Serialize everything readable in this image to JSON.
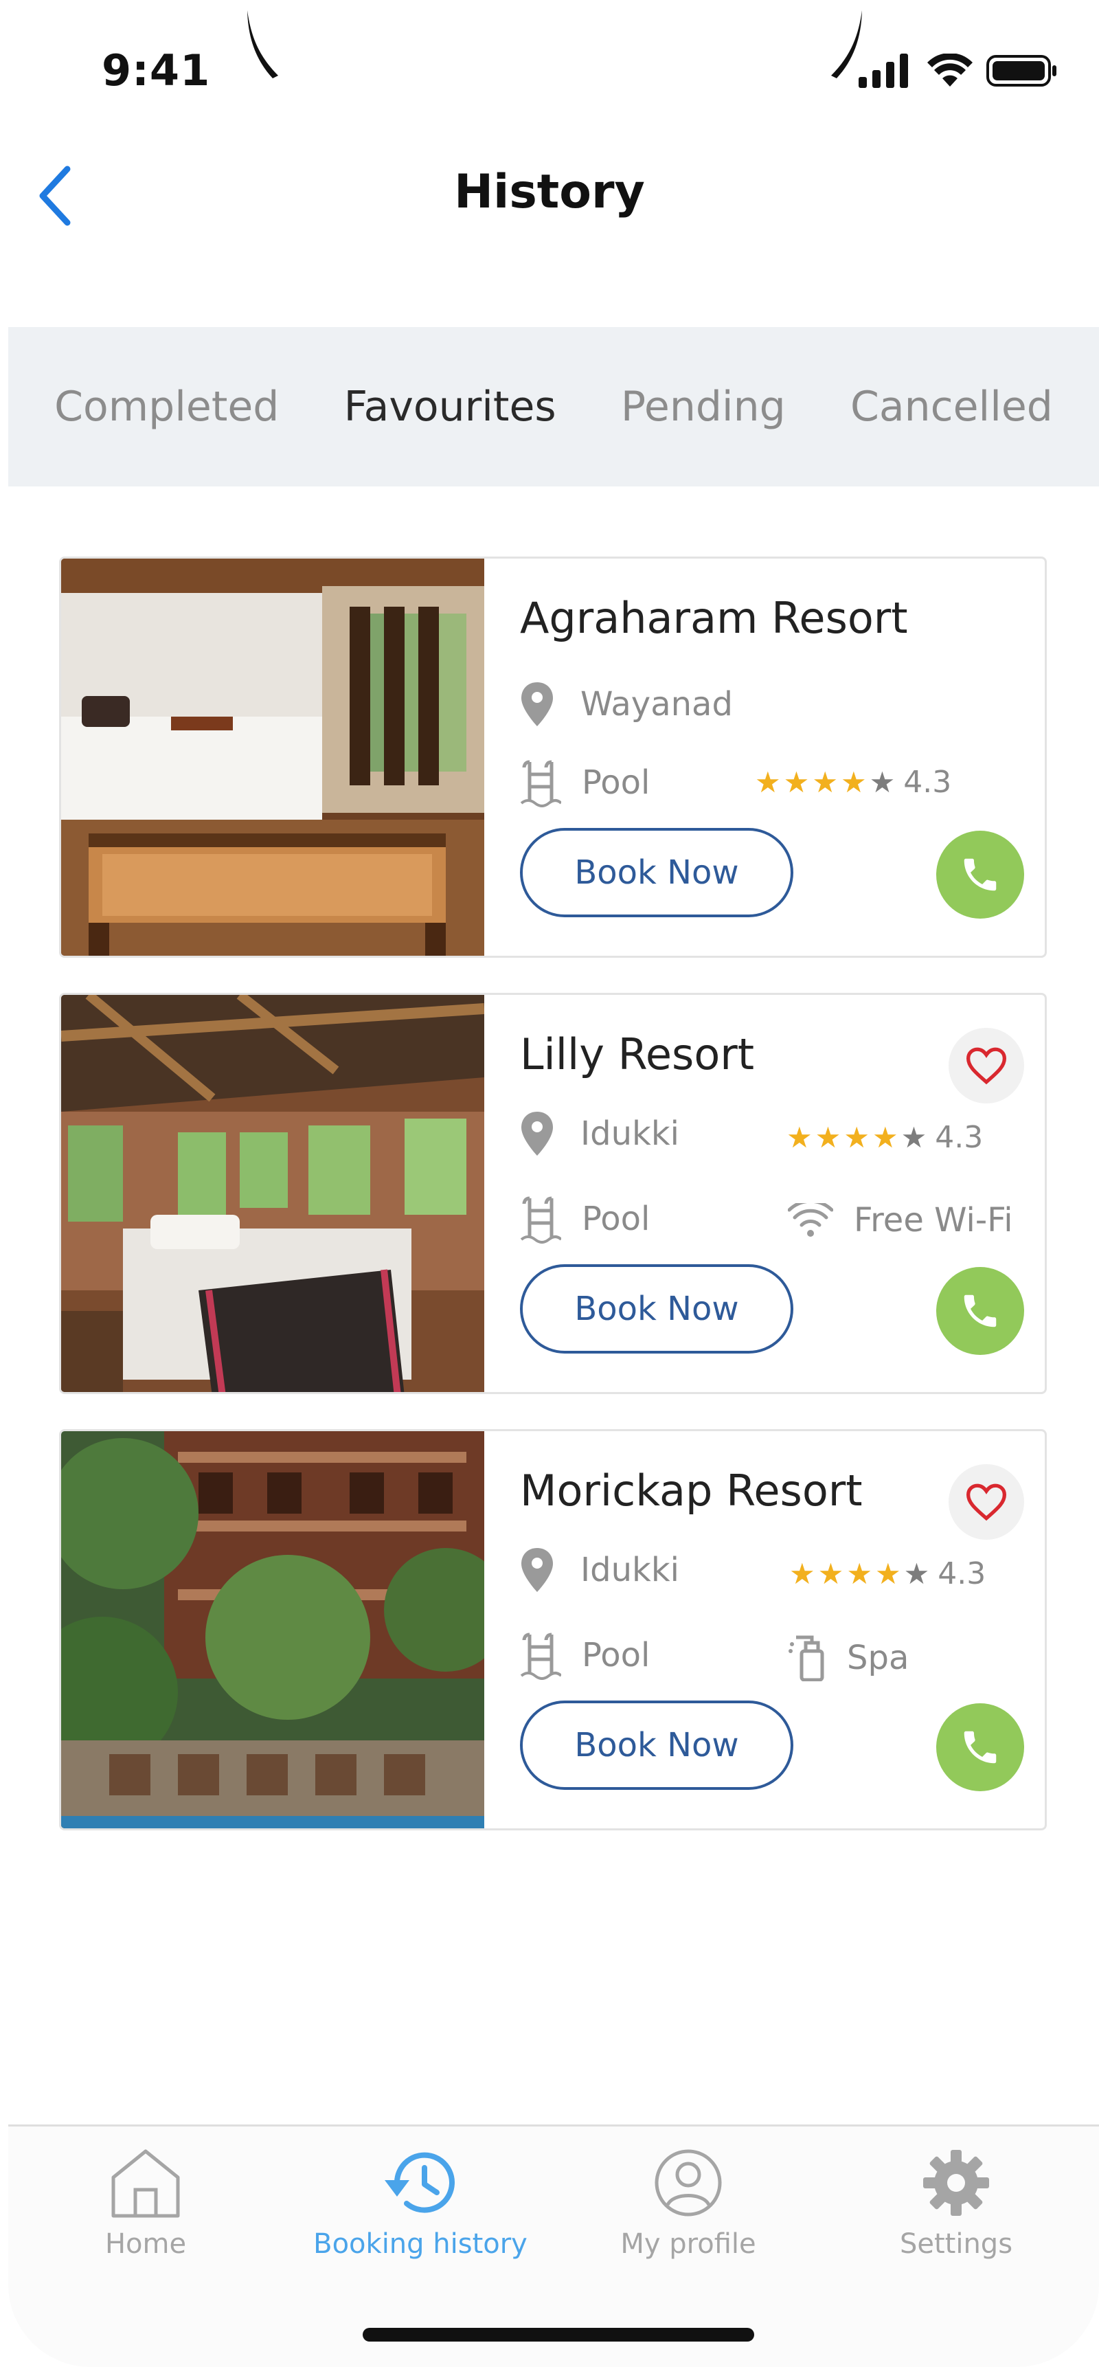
{
  "status_bar": {
    "time": "9:41"
  },
  "header": {
    "title": "History"
  },
  "tabs": [
    {
      "label": "Completed",
      "active": false
    },
    {
      "label": "Favourites",
      "active": true
    },
    {
      "label": "Pending",
      "active": false
    },
    {
      "label": "Cancelled",
      "active": false
    }
  ],
  "cards": [
    {
      "name": "Agraharam Resort",
      "location": "Wayanad",
      "amenities": [
        "Pool"
      ],
      "rating": {
        "value": "4.3",
        "stars": 4
      },
      "book_label": "Book Now",
      "favourite_shown": false
    },
    {
      "name": "Lilly Resort",
      "location": "Idukki",
      "amenities": [
        "Pool",
        "Free Wi-Fi"
      ],
      "rating": {
        "value": "4.3",
        "stars": 4
      },
      "book_label": "Book Now",
      "favourite_shown": true
    },
    {
      "name": "Morickap Resort",
      "location": "Idukki",
      "amenities": [
        "Pool",
        "Spa"
      ],
      "rating": {
        "value": "4.3",
        "stars": 4
      },
      "book_label": "Book Now",
      "favourite_shown": true
    }
  ],
  "bottom_nav": [
    {
      "label": "Home",
      "icon": "home-icon",
      "active": false
    },
    {
      "label": "Booking history",
      "icon": "history-icon",
      "active": true
    },
    {
      "label": "My profile",
      "icon": "profile-icon",
      "active": false
    },
    {
      "label": "Settings",
      "icon": "gear-icon",
      "active": false
    }
  ],
  "colors": {
    "accent": "#2e5a99",
    "call_green": "#92c95a",
    "star": "#f2b01e",
    "nav_active": "#4aa4ea",
    "back_arrow": "#1f7ae0",
    "heart": "#d9282f"
  }
}
